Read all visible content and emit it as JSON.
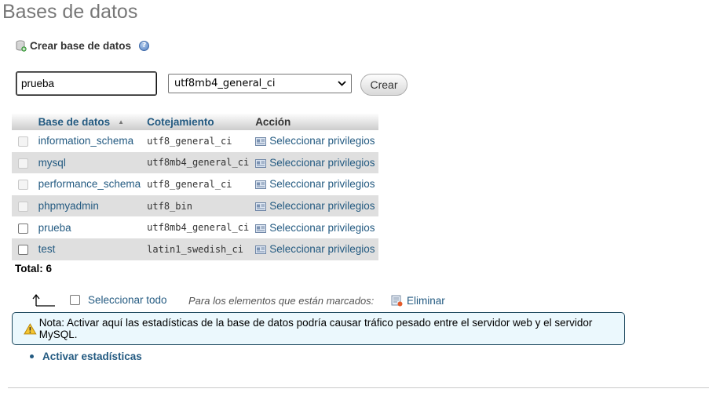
{
  "page": {
    "title": "Bases de datos"
  },
  "create": {
    "heading": "Crear base de datos",
    "input_value": "prueba",
    "collation_selected": "utf8mb4_general_ci",
    "button_label": "Crear"
  },
  "table": {
    "headers": {
      "name": "Base de datos",
      "collation": "Cotejamiento",
      "action": "Acción"
    },
    "rows": [
      {
        "name": "information_schema",
        "collation": "utf8_general_ci",
        "action": "Seleccionar privilegios",
        "checkbox_enabled": false
      },
      {
        "name": "mysql",
        "collation": "utf8mb4_general_ci",
        "action": "Seleccionar privilegios",
        "checkbox_enabled": false
      },
      {
        "name": "performance_schema",
        "collation": "utf8_general_ci",
        "action": "Seleccionar privilegios",
        "checkbox_enabled": false
      },
      {
        "name": "phpmyadmin",
        "collation": "utf8_bin",
        "action": "Seleccionar privilegios",
        "checkbox_enabled": false
      },
      {
        "name": "prueba",
        "collation": "utf8mb4_general_ci",
        "action": "Seleccionar privilegios",
        "checkbox_enabled": true
      },
      {
        "name": "test",
        "collation": "latin1_swedish_ci",
        "action": "Seleccionar privilegios",
        "checkbox_enabled": true
      }
    ],
    "total": "Total: 6"
  },
  "bulk": {
    "select_all": "Seleccionar todo",
    "marked_label": "Para los elementos que están marcados:",
    "delete_label": "Eliminar"
  },
  "notice": {
    "text": "Nota: Activar aquí las estadísticas de la base de datos podría causar tráfico pesado entre el servidor web y el servidor MySQL."
  },
  "stats": {
    "link": "Activar estadísticas"
  },
  "icons": {
    "create": "database-add-icon",
    "help": "help-icon",
    "sort": "sort-ascending-icon",
    "privileges": "privileges-icon",
    "arrow": "arrow-left-up-icon",
    "delete": "delete-icon",
    "warning": "warning-icon"
  },
  "colors": {
    "link": "#235a81",
    "notice_bg": "#ebf8fd",
    "notice_border": "#1e495f",
    "row_alt": "#dfdfdf"
  }
}
